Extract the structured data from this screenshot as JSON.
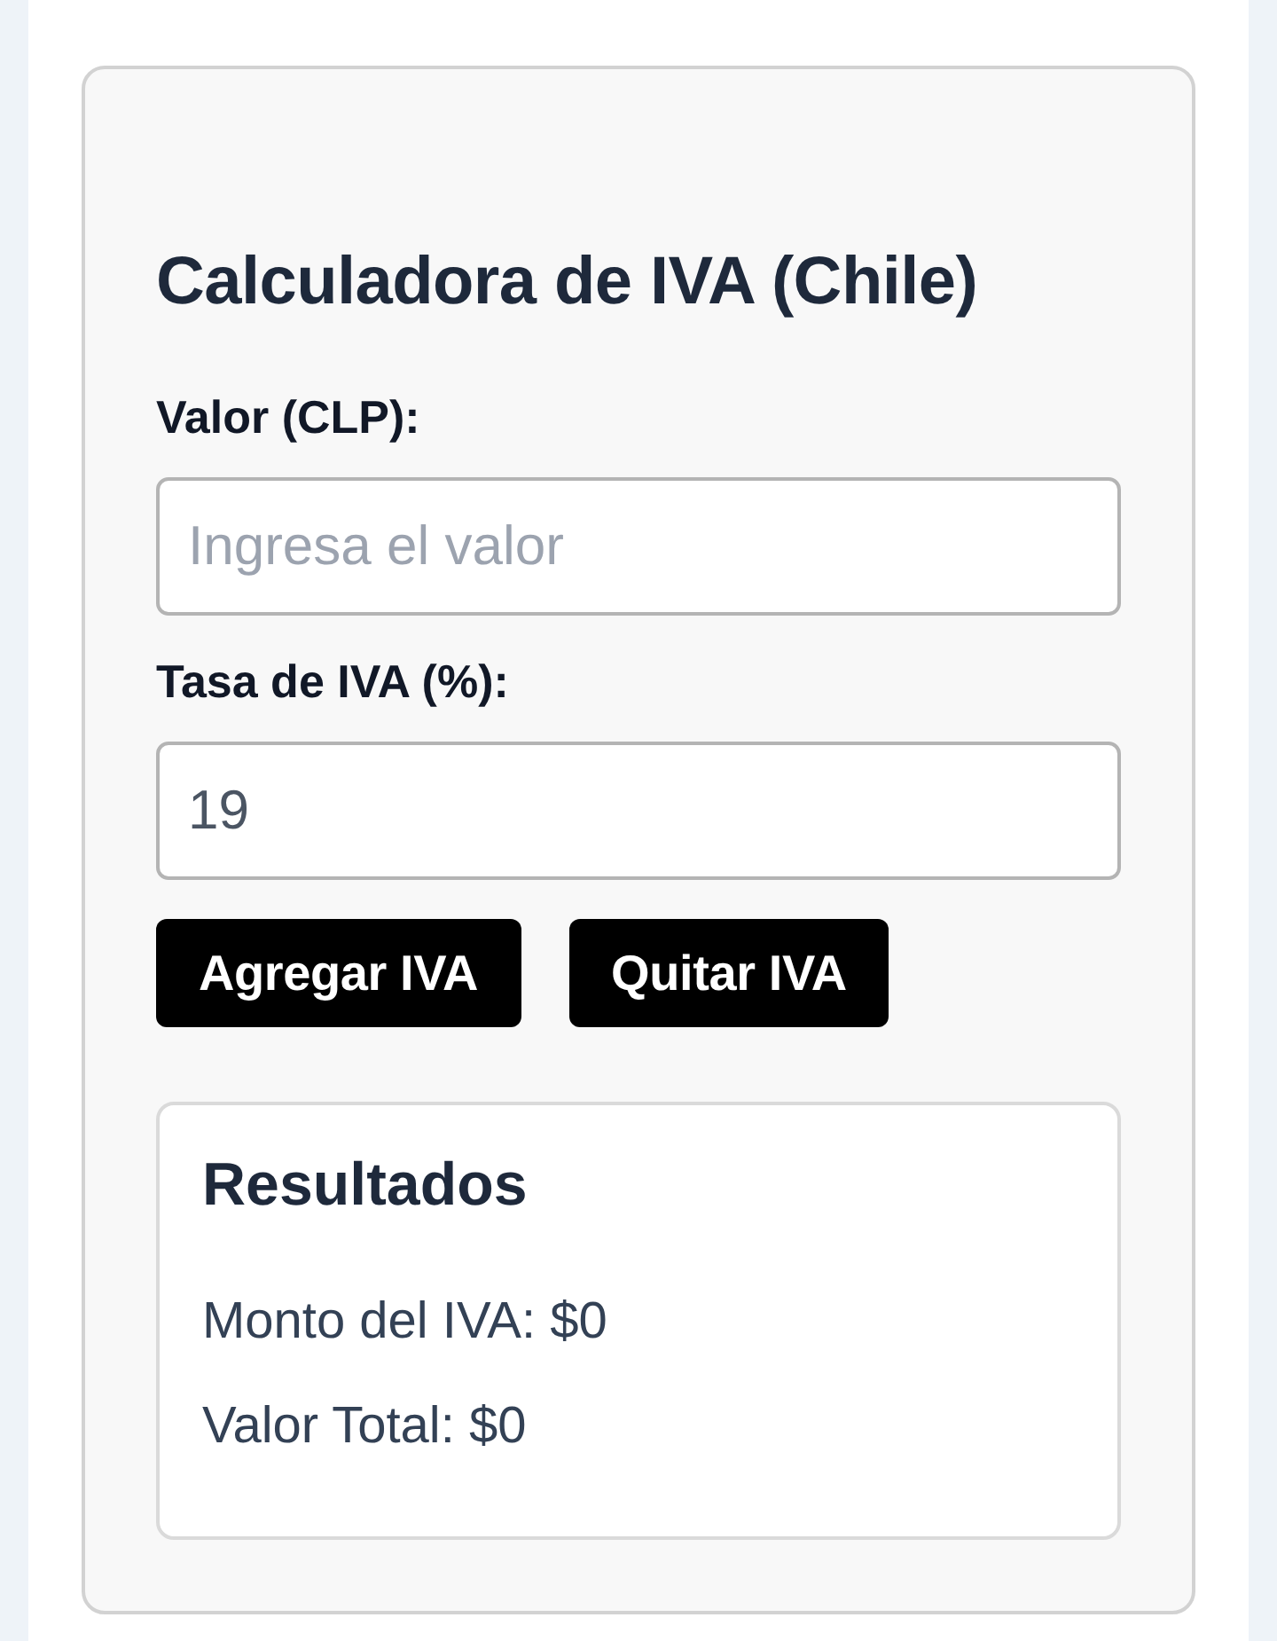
{
  "calculator": {
    "title": "Calculadora de IVA (Chile)",
    "fields": [
      {
        "label": "Valor (CLP):",
        "placeholder": "Ingresa el valor"
      },
      {
        "label": "Tasa de IVA (%):",
        "value": "19"
      }
    ],
    "buttons": [
      "Agregar IVA",
      "Quitar IVA"
    ],
    "results": {
      "title": "Resultados",
      "lines": [
        "Monto del IVA: $0",
        "Valor Total: $0"
      ]
    }
  }
}
